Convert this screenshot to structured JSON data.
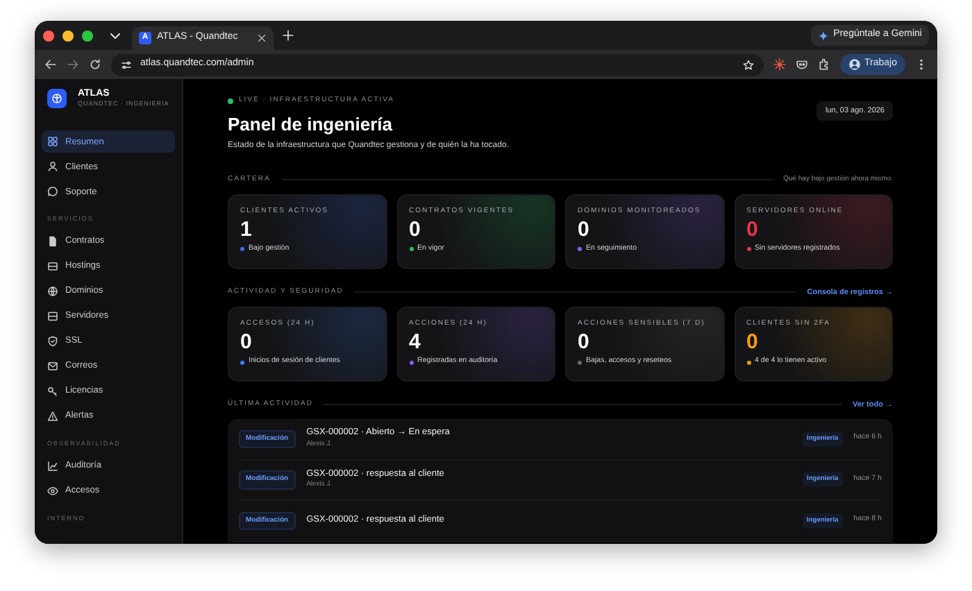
{
  "browser": {
    "tab": {
      "favicon": "A",
      "title": "ATLAS - Quandtec",
      "selected": true
    },
    "gemini_button": "Pregúntale a Gemini",
    "url": "atlas.quandtec.com/admin",
    "profile": "Trabajo"
  },
  "sidebar": {
    "brand": "ATLAS",
    "subtitle": "QUANDTEC · INGENIERÍA",
    "sections": [
      {
        "items": [
          {
            "label": "Resumen",
            "selected": true
          },
          {
            "label": "Clientes",
            "selected": false
          },
          {
            "label": "Soporte",
            "selected": false
          }
        ]
      },
      {
        "title": "SERVICIOS",
        "items": [
          {
            "label": "Contratos",
            "selected": false
          },
          {
            "label": "Hostings",
            "selected": false
          },
          {
            "label": "Dominios",
            "selected": false
          },
          {
            "label": "Servidores",
            "selected": false
          },
          {
            "label": "SSL",
            "selected": false
          },
          {
            "label": "Correos",
            "selected": false
          },
          {
            "label": "Licencias",
            "selected": false
          },
          {
            "label": "Alertas",
            "selected": false
          }
        ]
      },
      {
        "title": "OBSERVABILIDAD",
        "items": [
          {
            "label": "Auditoría",
            "selected": false
          },
          {
            "label": "Accesos",
            "selected": false
          }
        ]
      },
      {
        "title": "INTERNO"
      }
    ]
  },
  "header": {
    "status": "LIVE · INFRAESTRUCTURA ACTIVA",
    "live": true,
    "date": "lun, 03 ago. 2026",
    "title": "Panel de ingeniería",
    "subtitle": "Estado de la infraestructura que Quandtec gestiona y de quién la ha tocado."
  },
  "sections": [
    {
      "kind": "stats",
      "title": "CARTERA",
      "aside": {
        "kind": "note",
        "text": "Qué hay bajo gestión ahora mismo."
      },
      "cards": [
        {
          "label": "CLIENTES ACTIVOS",
          "value": "1",
          "note": "Bajo gestión",
          "color": "#3b6cf0",
          "highlight": false
        },
        {
          "label": "CONTRATOS VIGENTES",
          "value": "0",
          "note": "En vigor",
          "color": "#22c55e",
          "highlight": false
        },
        {
          "label": "DOMINIOS MONITOREADOS",
          "value": "0",
          "note": "En seguimiento",
          "color": "#8b5cf6",
          "highlight": false
        },
        {
          "label": "SERVIDORES ONLINE",
          "value": "0",
          "note": "Sin servidores registrados",
          "color": "#e5344a",
          "highlight": true
        }
      ]
    },
    {
      "kind": "stats",
      "title": "ACTIVIDAD Y SEGURIDAD",
      "aside": {
        "kind": "link",
        "text": "Consola de registros →"
      },
      "cards": [
        {
          "label": "ACCESOS (24 H)",
          "value": "0",
          "note": "Inicios de sesión de clientes",
          "color": "#3b82f6",
          "highlight": false
        },
        {
          "label": "ACCIONES (24 H)",
          "value": "4",
          "note": "Registradas en auditoría",
          "color": "#8b5cf6",
          "highlight": false
        },
        {
          "label": "ACCIONES SENSIBLES (7 D)",
          "value": "0",
          "note": "Bajas, accesos y reseteos",
          "color": "#6b6b70",
          "highlight": false
        },
        {
          "label": "CLIENTES SIN 2FA",
          "value": "0",
          "note": "4 de 4 lo tienen activo",
          "color": "#f59e0b",
          "highlight": true
        }
      ]
    },
    {
      "kind": "activity",
      "title": "ÚLTIMA ACTIVIDAD",
      "aside": {
        "kind": "link",
        "text": "Ver todo →"
      },
      "rows": [
        {
          "badge": "Modificación",
          "title": "GSX-000002 · Abierto → En espera",
          "author": "Alexis J.",
          "tag": "Ingeniería",
          "time": "hace 6 h"
        },
        {
          "badge": "Modificación",
          "title": "GSX-000002 · respuesta al cliente",
          "author": "Alexis J.",
          "tag": "Ingeniería",
          "time": "hace 7 h"
        },
        {
          "badge": "Modificación",
          "title": "GSX-000002 · respuesta al cliente",
          "tag": "Ingeniería",
          "time": "hace 8 h"
        }
      ]
    }
  ]
}
